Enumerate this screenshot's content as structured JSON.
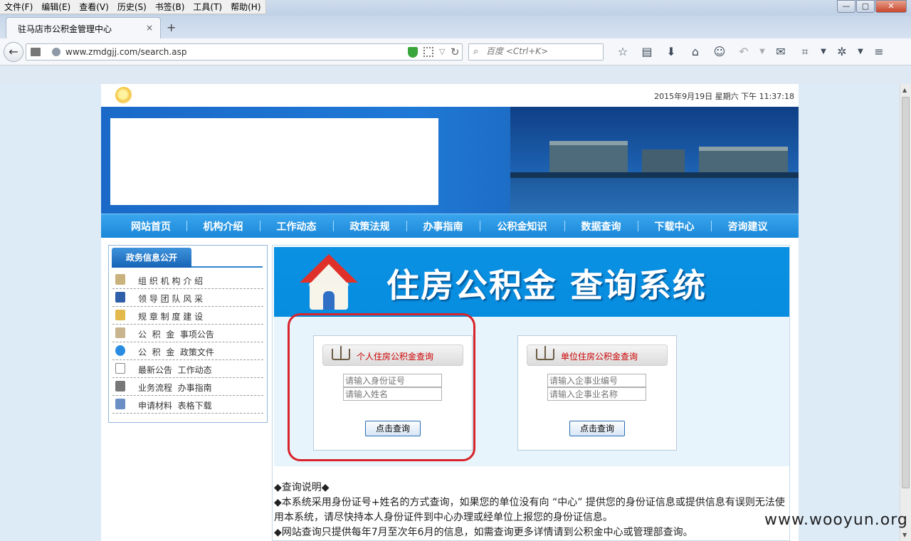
{
  "browser": {
    "menu": [
      "文件(F)",
      "编辑(E)",
      "查看(V)",
      "历史(S)",
      "书签(B)",
      "工具(T)",
      "帮助(H)"
    ],
    "window_controls": [
      "—",
      "▢",
      "✕"
    ],
    "tab_title": "驻马店市公积金管理中心",
    "tab_close": "×",
    "new_tab": "+",
    "url": "www.zmdgjj.com/search.asp",
    "search_placeholder": "百度 <Ctrl+K>"
  },
  "page": {
    "datetime": "2015年9月19日  星期六  下午  11:37:18",
    "nav": [
      "网站首页",
      "机构介绍",
      "工作动态",
      "政策法规",
      "办事指南",
      "公积金知识",
      "数据查询",
      "下载中心",
      "咨询建议"
    ],
    "sidebar": {
      "title": "政务信息公开",
      "items": [
        {
          "label": "组 织 机 构 介 绍",
          "icon": "book-icon",
          "color": "#c9b27c"
        },
        {
          "label": "领 导 团 队 风 采",
          "icon": "file-blue-icon",
          "color": "#2f5fa8"
        },
        {
          "label": "规 章 制 度 建 设",
          "icon": "folder-icon",
          "color": "#e2b94a"
        },
        {
          "label": "公  积  金  事项公告",
          "icon": "badge-icon",
          "color": "#c8b48d"
        },
        {
          "label": "公  积  金  政策文件",
          "icon": "globe-icon",
          "color": "#2a8ce0"
        },
        {
          "label": "最新公告  工作动态",
          "icon": "clipboard-icon",
          "color": "#c9c9c9"
        },
        {
          "label": "业务流程  办事指南",
          "icon": "calculator-icon",
          "color": "#777777"
        },
        {
          "label": "申请材料  表格下载",
          "icon": "document-icon",
          "color": "#6a8fc4"
        }
      ]
    },
    "query": {
      "banner_title": "住房公积金 查询系统",
      "personal": {
        "title": "个人住房公积金查询",
        "field1_placeholder": "请输入身份证号",
        "field2_placeholder": "请输入姓名",
        "button": "点击查询"
      },
      "unit": {
        "title": "单位住房公积金查询",
        "field1_placeholder": "请输入企事业编号",
        "field2_placeholder": "请输入企事业名称",
        "button": "点击查询"
      }
    },
    "notes": [
      "◆查询说明◆",
      "◆本系统采用身份证号+姓名的方式查询，如果您的单位没有向 “中心” 提供您的身份证信息或提供信息有误则无法使用本系统，请尽快持本人身份证件到中心办理或经单位上报您的身份证信息。",
      "◆网站查询只提供每年7月至次年6月的信息，如需查询更多详情请到公积金中心或管理部查询。"
    ]
  },
  "watermark": "www.wooyun.org",
  "colors": {
    "nav_blue": "#1a88d8",
    "banner_blue": "#078de0",
    "highlight_red": "#d8232a",
    "query_title_red": "#cc0000"
  }
}
